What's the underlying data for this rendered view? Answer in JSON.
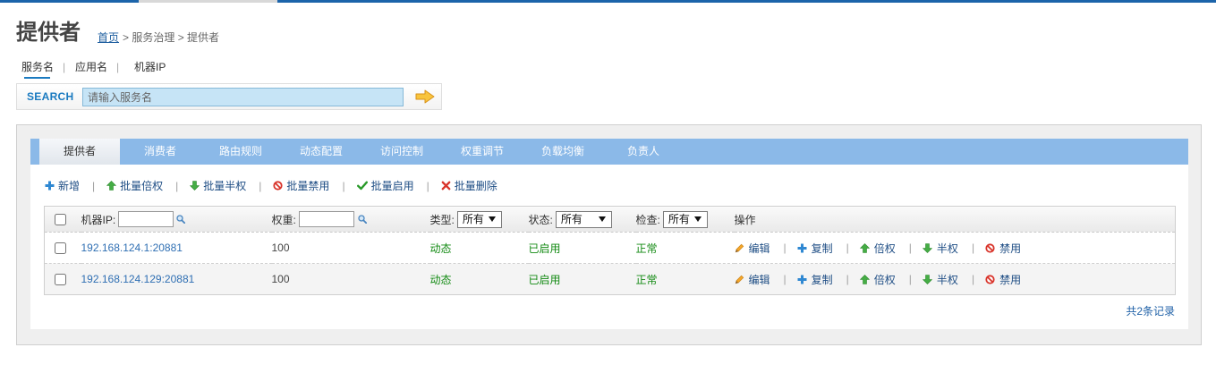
{
  "header": {
    "title": "提供者",
    "breadcrumb_home": "首页",
    "breadcrumb_rest": "> 服务治理 > 提供者"
  },
  "separator": "|",
  "search_tabs": [
    {
      "label": "服务名",
      "active": true
    },
    {
      "label": "应用名",
      "active": false
    },
    {
      "label": "机器IP",
      "active": false
    }
  ],
  "search": {
    "label": "SEARCH",
    "placeholder": "请输入服务名",
    "submit_icon": "arrow-right-icon"
  },
  "tabs": [
    {
      "label": "提供者",
      "active": true
    },
    {
      "label": "消费者",
      "active": false
    },
    {
      "label": "路由规则",
      "active": false
    },
    {
      "label": "动态配置",
      "active": false
    },
    {
      "label": "访问控制",
      "active": false
    },
    {
      "label": "权重调节",
      "active": false
    },
    {
      "label": "负载均衡",
      "active": false
    },
    {
      "label": "负责人",
      "active": false
    }
  ],
  "toolbar": [
    {
      "label": "新增",
      "icon": "plus-icon"
    },
    {
      "label": "批量倍权",
      "icon": "arrow-up-icon"
    },
    {
      "label": "批量半权",
      "icon": "arrow-down-icon"
    },
    {
      "label": "批量禁用",
      "icon": "ban-icon"
    },
    {
      "label": "批量启用",
      "icon": "check-icon"
    },
    {
      "label": "批量删除",
      "icon": "delete-icon"
    }
  ],
  "table": {
    "header": {
      "select_all_checked": false,
      "ip_label": "机器IP:",
      "ip_filter_icon": "search-icon",
      "weight_label": "权重:",
      "weight_filter_icon": "search-icon",
      "type_label": "类型:",
      "type_selected": "所有",
      "status_label": "状态:",
      "status_selected": "所有",
      "check_label": "检查:",
      "check_selected": "所有",
      "actions_label": "操作"
    },
    "rows": [
      {
        "checked": false,
        "ip": "192.168.124.1:20881",
        "weight": "100",
        "type": "动态",
        "status": "已启用",
        "check": "正常"
      },
      {
        "checked": false,
        "ip": "192.168.124.129:20881",
        "weight": "100",
        "type": "动态",
        "status": "已启用",
        "check": "正常"
      }
    ],
    "row_actions": [
      {
        "label": "编辑",
        "icon": "pencil-icon"
      },
      {
        "label": "复制",
        "icon": "plus-icon"
      },
      {
        "label": "倍权",
        "icon": "arrow-up-icon"
      },
      {
        "label": "半权",
        "icon": "arrow-down-icon"
      },
      {
        "label": "禁用",
        "icon": "ban-icon"
      }
    ]
  },
  "footer": {
    "record_count": "共2条记录"
  },
  "colors": {
    "top_bar": "#1c64aa",
    "tab_bar": "#8bb9e8",
    "link": "#2f6fb3",
    "action_text": "#1f4e85",
    "status_ok": "#138a13",
    "accent": "#1a7ac0",
    "danger": "#d9342b",
    "search_input_bg": "#c6e4f6"
  }
}
